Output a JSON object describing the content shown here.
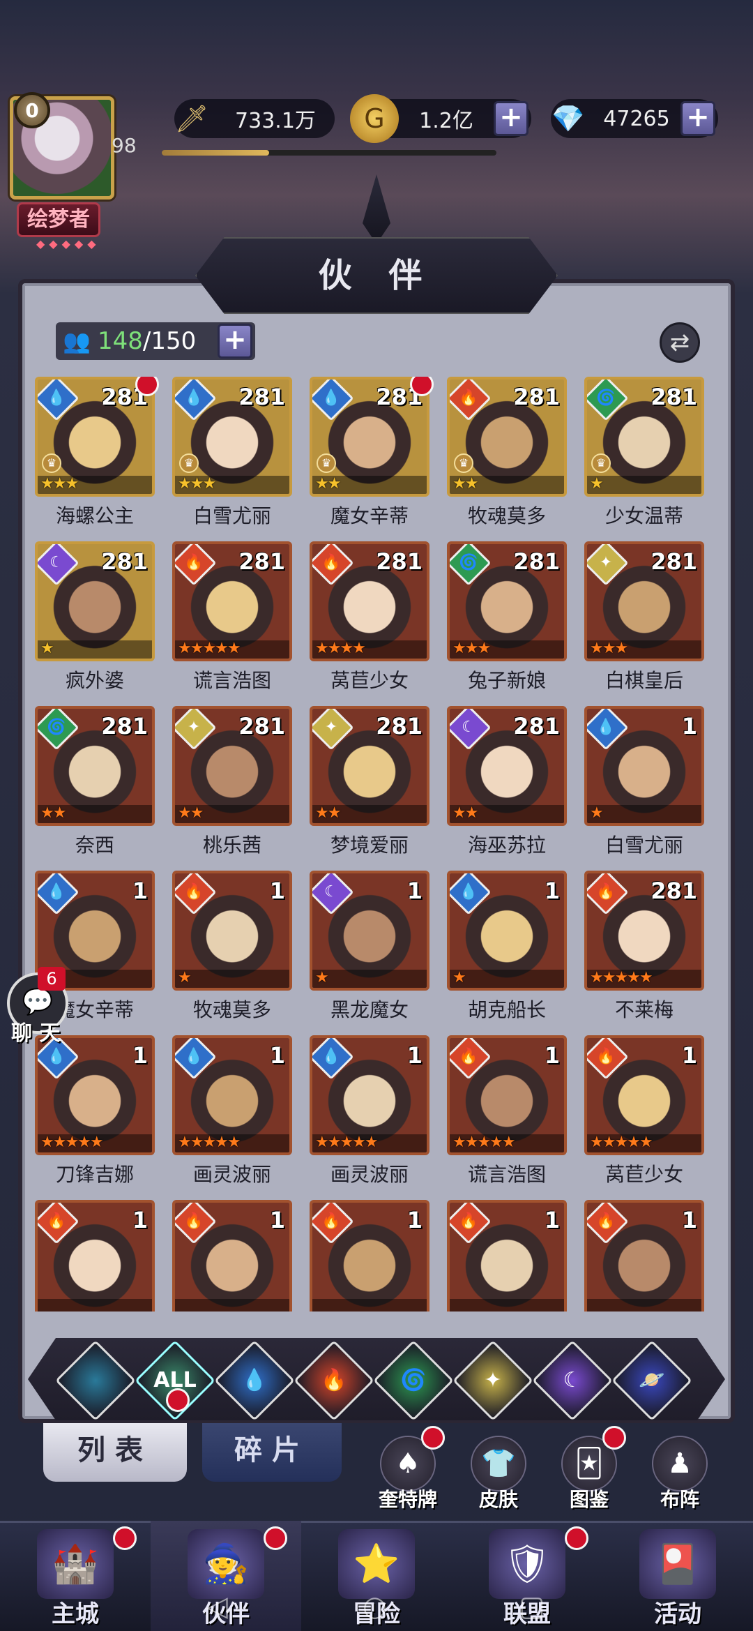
{
  "header": {
    "vip": "0",
    "level": "98",
    "title_badge": "绘梦者",
    "power": "733.1万",
    "gold": "1.2亿",
    "diamonds": "47265",
    "xp_fraction": 0.32
  },
  "panel": {
    "title": "伙 伴",
    "count_current": "148",
    "count_total": "/150"
  },
  "cards": [
    {
      "name": "海螺公主",
      "level": "281",
      "element": "water",
      "stars": 3,
      "star_color": "gold",
      "badge": true,
      "crown": true,
      "border": "gold"
    },
    {
      "name": "白雪尤丽",
      "level": "281",
      "element": "water",
      "stars": 3,
      "star_color": "gold",
      "badge": false,
      "crown": true,
      "border": "gold"
    },
    {
      "name": "魔女辛蒂",
      "level": "281",
      "element": "water",
      "stars": 2,
      "star_color": "gold",
      "badge": true,
      "crown": true,
      "border": "gold"
    },
    {
      "name": "牧魂莫多",
      "level": "281",
      "element": "fire",
      "stars": 2,
      "star_color": "gold",
      "badge": false,
      "crown": true,
      "border": "gold"
    },
    {
      "name": "少女温蒂",
      "level": "281",
      "element": "wind",
      "stars": 1,
      "star_color": "gold",
      "badge": false,
      "crown": true,
      "border": "gold"
    },
    {
      "name": "疯外婆",
      "level": "281",
      "element": "dark",
      "stars": 1,
      "star_color": "gold",
      "badge": false,
      "crown": false,
      "border": "gold"
    },
    {
      "name": "谎言浩图",
      "level": "281",
      "element": "fire",
      "stars": 5,
      "star_color": "orange",
      "badge": false,
      "crown": false,
      "border": "red"
    },
    {
      "name": "莴苣少女",
      "level": "281",
      "element": "fire",
      "stars": 4,
      "star_color": "orange",
      "badge": false,
      "crown": false,
      "border": "red"
    },
    {
      "name": "兔子新娘",
      "level": "281",
      "element": "wind",
      "stars": 3,
      "star_color": "orange",
      "badge": false,
      "crown": false,
      "border": "red"
    },
    {
      "name": "白棋皇后",
      "level": "281",
      "element": "light",
      "stars": 3,
      "star_color": "orange",
      "badge": false,
      "crown": false,
      "border": "red"
    },
    {
      "name": "奈西",
      "level": "281",
      "element": "wind",
      "stars": 2,
      "star_color": "orange",
      "badge": false,
      "crown": false,
      "border": "red"
    },
    {
      "name": "桃乐茜",
      "level": "281",
      "element": "light",
      "stars": 2,
      "star_color": "orange",
      "badge": false,
      "crown": false,
      "border": "red"
    },
    {
      "name": "梦境爱丽",
      "level": "281",
      "element": "light",
      "stars": 2,
      "star_color": "orange",
      "badge": false,
      "crown": false,
      "border": "red"
    },
    {
      "name": "海巫苏拉",
      "level": "281",
      "element": "dark",
      "stars": 2,
      "star_color": "orange",
      "badge": false,
      "crown": false,
      "border": "red"
    },
    {
      "name": "白雪尤丽",
      "level": "1",
      "element": "water",
      "stars": 1,
      "star_color": "orange",
      "badge": false,
      "crown": false,
      "border": "red"
    },
    {
      "name": "魔女辛蒂",
      "level": "1",
      "element": "water",
      "stars": 1,
      "star_color": "orange",
      "badge": false,
      "crown": false,
      "border": "red"
    },
    {
      "name": "牧魂莫多",
      "level": "1",
      "element": "fire",
      "stars": 1,
      "star_color": "orange",
      "badge": false,
      "crown": false,
      "border": "red"
    },
    {
      "name": "黑龙魔女",
      "level": "1",
      "element": "dark",
      "stars": 1,
      "star_color": "orange",
      "badge": false,
      "crown": false,
      "border": "red"
    },
    {
      "name": "胡克船长",
      "level": "1",
      "element": "water",
      "stars": 1,
      "star_color": "orange",
      "badge": false,
      "crown": false,
      "border": "red"
    },
    {
      "name": "不莱梅",
      "level": "281",
      "element": "fire",
      "stars": 5,
      "star_color": "orange",
      "badge": false,
      "crown": false,
      "border": "red"
    },
    {
      "name": "刀锋吉娜",
      "level": "1",
      "element": "water",
      "stars": 5,
      "star_color": "orange",
      "badge": false,
      "crown": false,
      "border": "red"
    },
    {
      "name": "画灵波丽",
      "level": "1",
      "element": "water",
      "stars": 5,
      "star_color": "orange",
      "badge": false,
      "crown": false,
      "border": "red"
    },
    {
      "name": "画灵波丽",
      "level": "1",
      "element": "water",
      "stars": 5,
      "star_color": "orange",
      "badge": false,
      "crown": false,
      "border": "red"
    },
    {
      "name": "谎言浩图",
      "level": "1",
      "element": "fire",
      "stars": 5,
      "star_color": "orange",
      "badge": false,
      "crown": false,
      "border": "red"
    },
    {
      "name": "莴苣少女",
      "level": "1",
      "element": "fire",
      "stars": 5,
      "star_color": "orange",
      "badge": false,
      "crown": false,
      "border": "red"
    },
    {
      "name": "",
      "level": "1",
      "element": "fire",
      "stars": 0,
      "star_color": "orange",
      "badge": false,
      "crown": false,
      "border": "red"
    },
    {
      "name": "",
      "level": "1",
      "element": "fire",
      "stars": 0,
      "star_color": "orange",
      "badge": false,
      "crown": false,
      "border": "red"
    },
    {
      "name": "",
      "level": "1",
      "element": "fire",
      "stars": 0,
      "star_color": "orange",
      "badge": false,
      "crown": false,
      "border": "red"
    },
    {
      "name": "",
      "level": "1",
      "element": "fire",
      "stars": 0,
      "star_color": "orange",
      "badge": false,
      "crown": false,
      "border": "red"
    },
    {
      "name": "",
      "level": "1",
      "element": "fire",
      "stars": 0,
      "star_color": "orange",
      "badge": false,
      "crown": false,
      "border": "red"
    }
  ],
  "element_colors": {
    "water": "#2f6fc9",
    "fire": "#d6452a",
    "wind": "#2d9a52",
    "dark": "#7a4ad0",
    "light": "#c7b24a",
    "ether": "#3a48c0"
  },
  "filters": [
    {
      "name": "filter-void",
      "label": "",
      "color": "#2a7a9a"
    },
    {
      "name": "filter-all",
      "label": "ALL",
      "color": "#3a8a6a"
    },
    {
      "name": "filter-water",
      "label": "💧",
      "color": "#2f6fc9"
    },
    {
      "name": "filter-fire",
      "label": "🔥",
      "color": "#d6452a"
    },
    {
      "name": "filter-wind",
      "label": "🌀",
      "color": "#2d9a52"
    },
    {
      "name": "filter-light",
      "label": "✦",
      "color": "#c7b24a"
    },
    {
      "name": "filter-dark",
      "label": "☾",
      "color": "#7a4ad0"
    },
    {
      "name": "filter-ether",
      "label": "🪐",
      "color": "#3a48c0"
    }
  ],
  "tabs": {
    "list": "列表",
    "fragments": "碎片"
  },
  "tools": [
    {
      "label": "奎特牌",
      "icon": "♠",
      "dot": true
    },
    {
      "label": "皮肤",
      "icon": "👕",
      "dot": false
    },
    {
      "label": "图鉴",
      "icon": "🃏",
      "dot": true
    },
    {
      "label": "布阵",
      "icon": "♟",
      "dot": false
    }
  ],
  "chat": {
    "label": "聊 天",
    "count": "6"
  },
  "nav": [
    {
      "label": "主城",
      "icon": "🏰",
      "dot": true
    },
    {
      "label": "伙伴",
      "icon": "🧙",
      "dot": true
    },
    {
      "label": "冒险",
      "icon": "⭐",
      "dot": false
    },
    {
      "label": "联盟",
      "icon": "🛡",
      "dot": true
    },
    {
      "label": "活动",
      "icon": "🎴",
      "dot": false
    }
  ]
}
